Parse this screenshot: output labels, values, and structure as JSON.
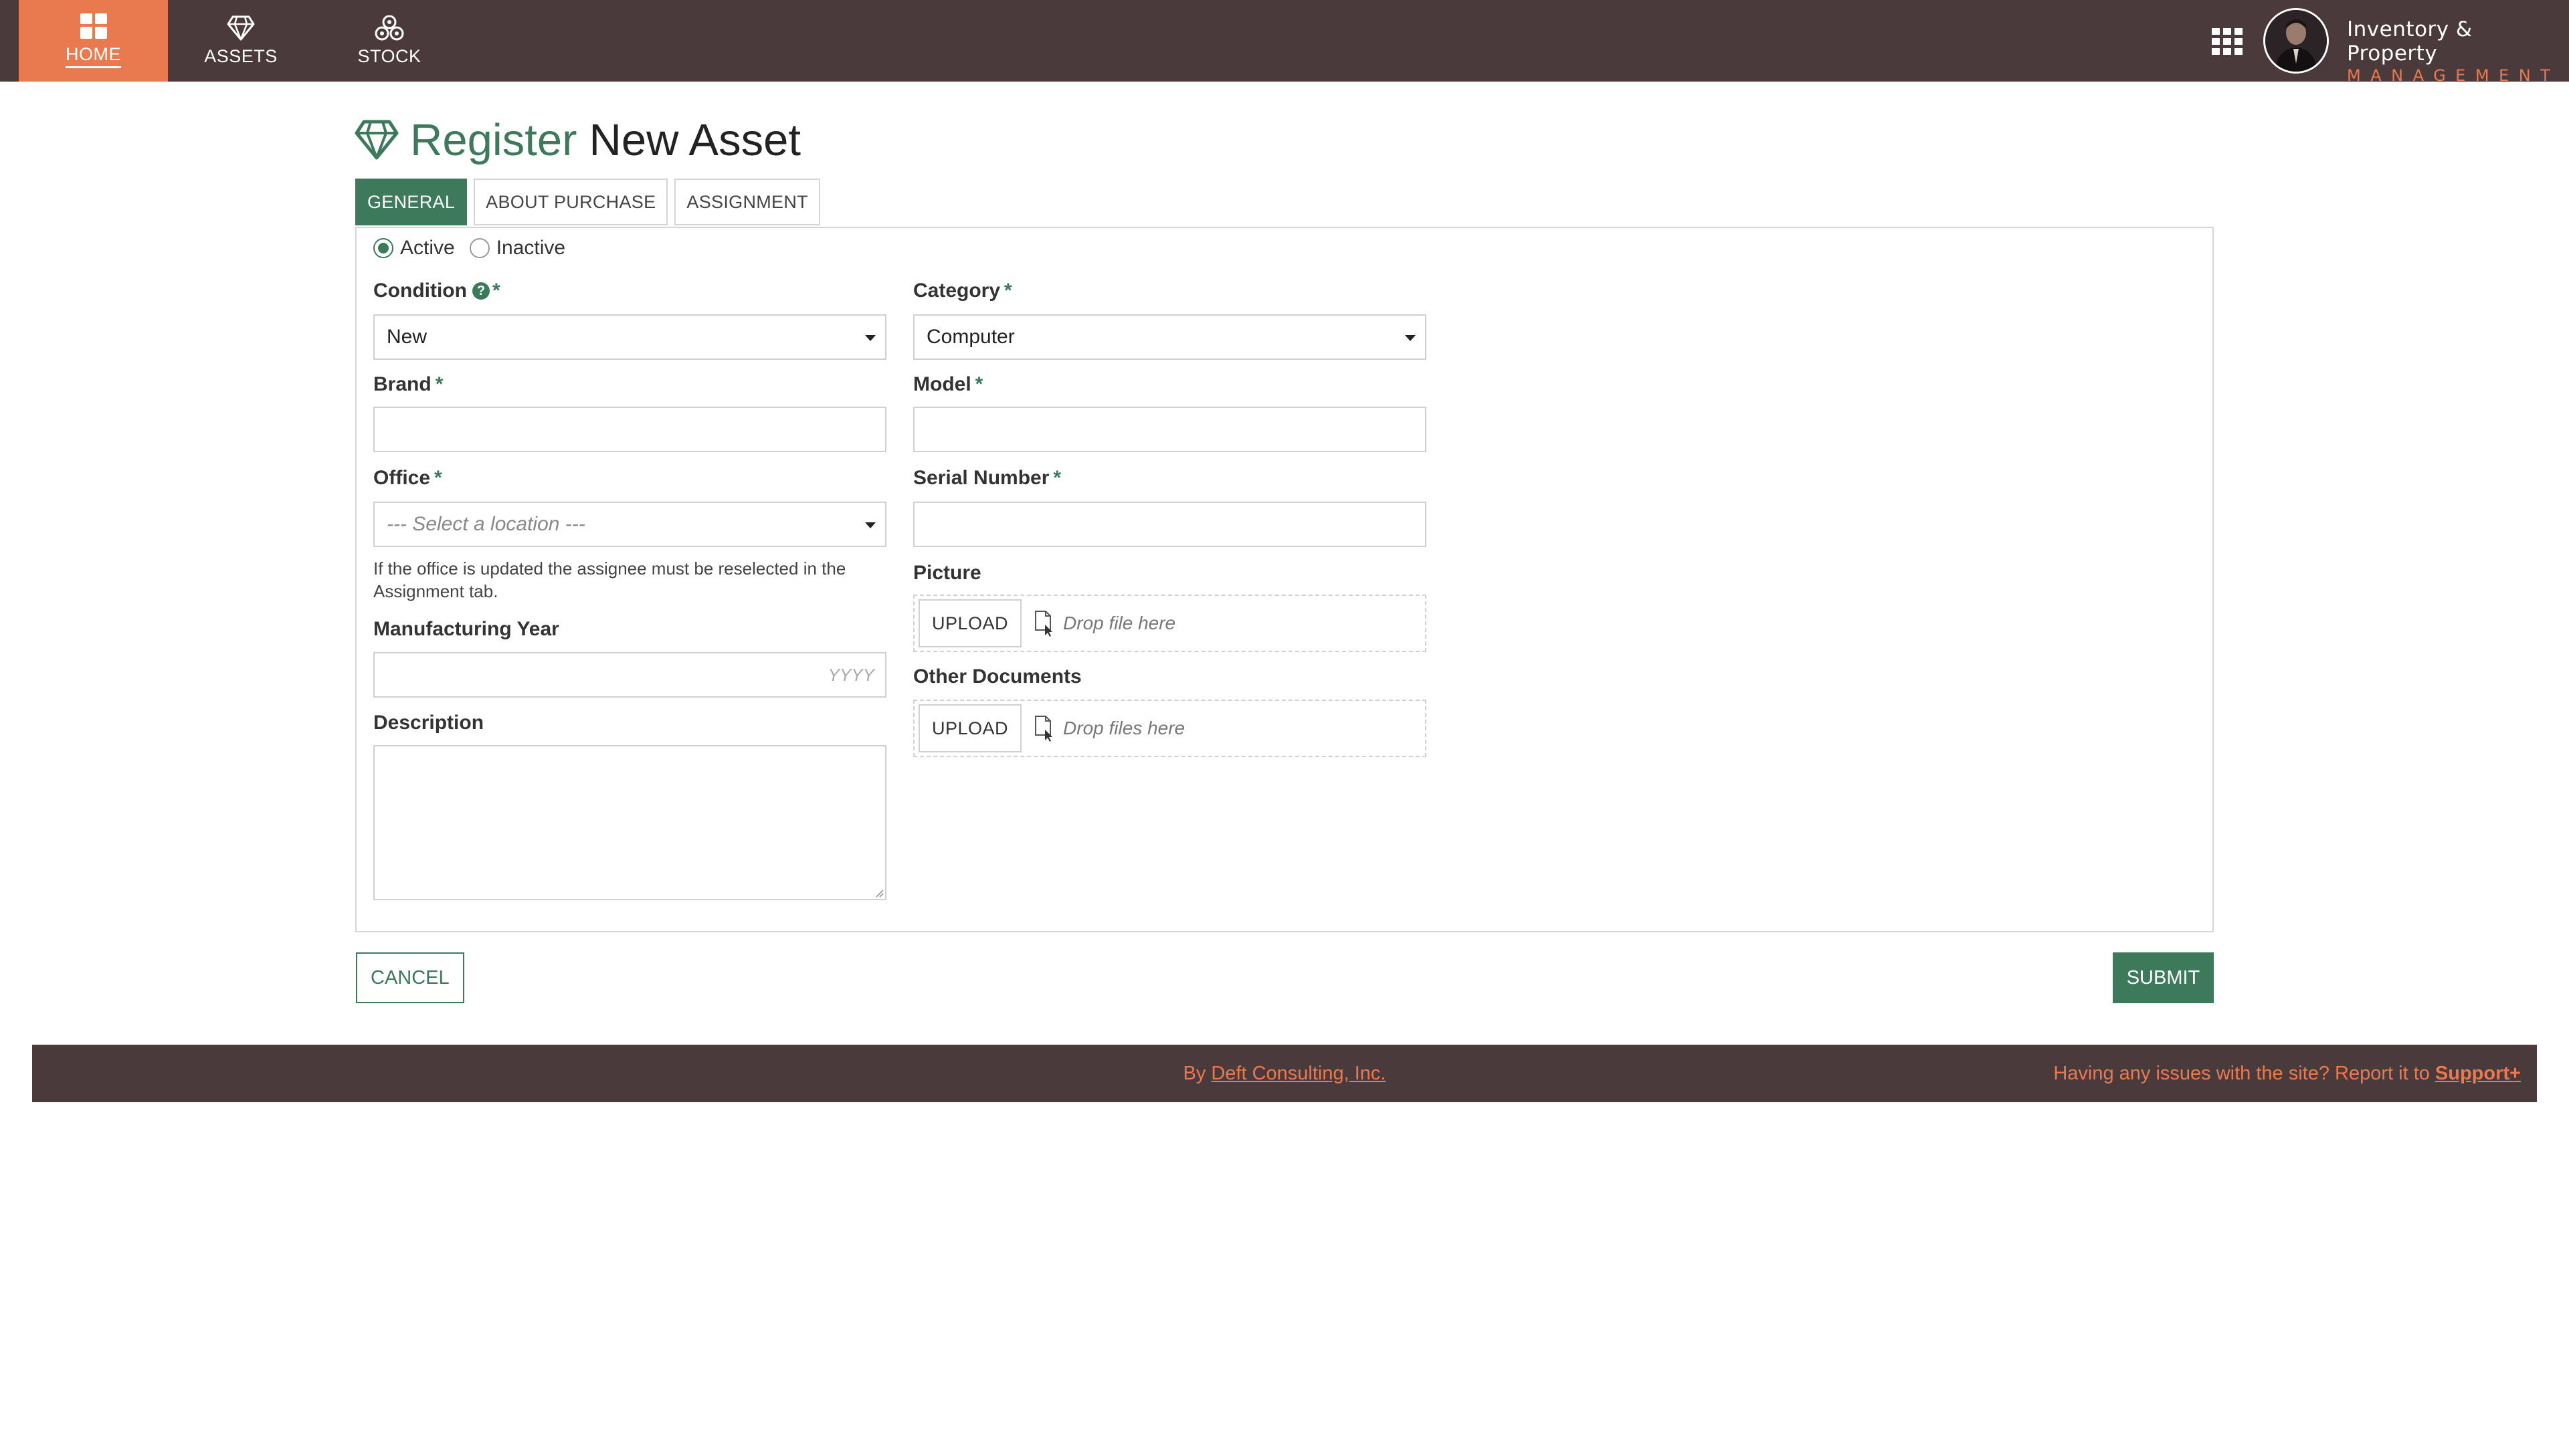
{
  "nav": {
    "items": [
      {
        "label": "HOME",
        "icon": "dashboard-grid-icon"
      },
      {
        "label": "ASSETS",
        "icon": "diamond-icon"
      },
      {
        "label": "STOCK",
        "icon": "boxes-icon"
      }
    ],
    "brand_line1": "Inventory & Property",
    "brand_line2": "MANAGEMENT"
  },
  "page": {
    "title_accent": "Register",
    "title_rest": "New Asset"
  },
  "tabs": [
    {
      "label": "GENERAL",
      "active": true
    },
    {
      "label": "ABOUT PURCHASE",
      "active": false
    },
    {
      "label": "ASSIGNMENT",
      "active": false
    }
  ],
  "form": {
    "status": {
      "active_label": "Active",
      "inactive_label": "Inactive",
      "selected": "Active"
    },
    "condition": {
      "label": "Condition",
      "value": "New"
    },
    "category": {
      "label": "Category",
      "value": "Computer"
    },
    "brand": {
      "label": "Brand",
      "value": ""
    },
    "model": {
      "label": "Model",
      "value": ""
    },
    "office": {
      "label": "Office",
      "placeholder": "--- Select a location ---",
      "hint": "If the office is updated the assignee must be reselected in the Assignment tab."
    },
    "serial": {
      "label": "Serial Number",
      "value": ""
    },
    "picture": {
      "label": "Picture",
      "button": "UPLOAD",
      "drop": "Drop file here"
    },
    "manufacturing_year": {
      "label": "Manufacturing Year",
      "placeholder": "YYYY"
    },
    "other_docs": {
      "label": "Other Documents",
      "button": "UPLOAD",
      "drop": "Drop files here"
    },
    "description": {
      "label": "Description",
      "value": ""
    },
    "required_mark": "*",
    "help_mark": "?"
  },
  "actions": {
    "cancel": "CANCEL",
    "submit": "SUBMIT"
  },
  "footer": {
    "by_prefix": "By",
    "company": "Deft Consulting, Inc.",
    "issues_text": "Having any issues with the site? Report it to",
    "support": "Support+"
  },
  "colors": {
    "nav_bg": "#4a3a3c",
    "accent_orange": "#e97a4f",
    "accent_green": "#3d7a5c"
  }
}
